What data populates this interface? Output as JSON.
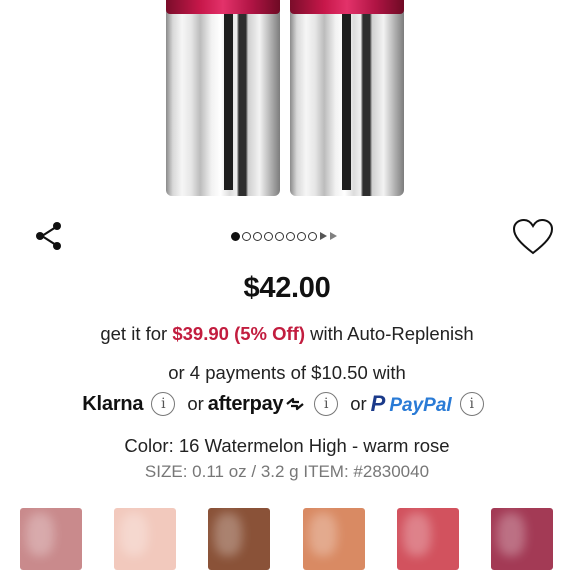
{
  "product_images": {
    "tube_colors": {
      "cap": "#c7174a",
      "body": "#e6e6e6",
      "stripe": "#1e1e1e"
    }
  },
  "carousel": {
    "total_dots": 8,
    "active_index": 0
  },
  "price": "$42.00",
  "auto_replenish": {
    "prefix": "get it for ",
    "sale_text": "$39.90 (5% Off)",
    "suffix": " with Auto-Replenish",
    "sale_color": "#c21d3f"
  },
  "installments": {
    "text": "or 4 payments of $10.50 with",
    "klarna": "Klarna",
    "or_1": "or",
    "afterpay": "afterpay",
    "or_2": "or",
    "paypal_p": "P",
    "paypal": "PayPal",
    "info_glyph": "i"
  },
  "color_line": "Color: 16 Watermelon High - warm rose",
  "size_line": "SIZE: 0.11 oz / 3.2 g ITEM: #2830040",
  "swatches": [
    {
      "color": "#c98a8c"
    },
    {
      "color": "#f2c9bd"
    },
    {
      "color": "#8a5238"
    },
    {
      "color": "#d98a63"
    },
    {
      "color": "#d2525e"
    },
    {
      "color": "#a33a55"
    }
  ],
  "icons": {
    "share": "share-icon",
    "favorite": "heart-icon"
  }
}
